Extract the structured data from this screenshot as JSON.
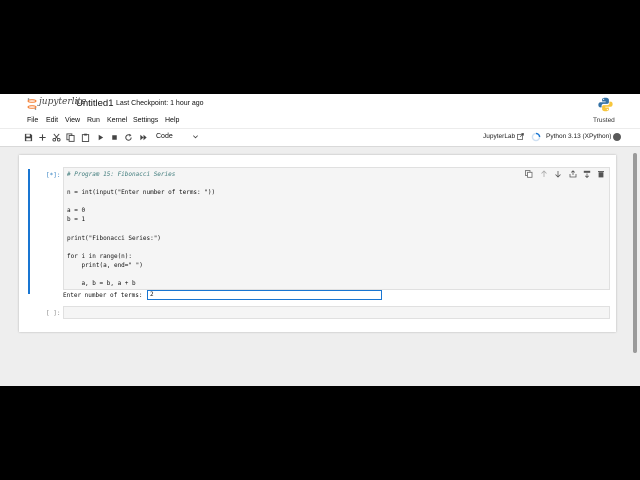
{
  "app": {
    "logo_text": "jupyterlite",
    "notebook_name": "Untitled1",
    "checkpoint": "Last Checkpoint: 1 hour ago"
  },
  "menu": [
    "File",
    "Edit",
    "View",
    "Run",
    "Kernel",
    "Settings",
    "Help"
  ],
  "trusted": "Trusted",
  "toolbar": {
    "icons": [
      "save-icon",
      "add-cell-icon",
      "cut-icon",
      "copy-icon",
      "paste-icon",
      "run-icon",
      "stop-icon",
      "restart-icon",
      "run-all-icon"
    ],
    "cell_type": "Code",
    "kernel_link": "JupyterLab",
    "kernel_name": "Python 3.13 (XPython)"
  },
  "cells": [
    {
      "prompt": "[*]:",
      "code": [
        "# Program 15: Fibonacci Series",
        "",
        "n = int(input(\"Enter number of terms: \"))",
        "",
        "a = 0",
        "b = 1",
        "",
        "print(\"Fibonacci Series:\")",
        "",
        "for i in range(n):",
        "    print(a, end=\" \")",
        "",
        "    a, b = b, a + b"
      ],
      "stdin_prompt": "Enter number of terms:",
      "stdin_value": "2"
    },
    {
      "prompt": "[ ]:",
      "code": []
    }
  ]
}
